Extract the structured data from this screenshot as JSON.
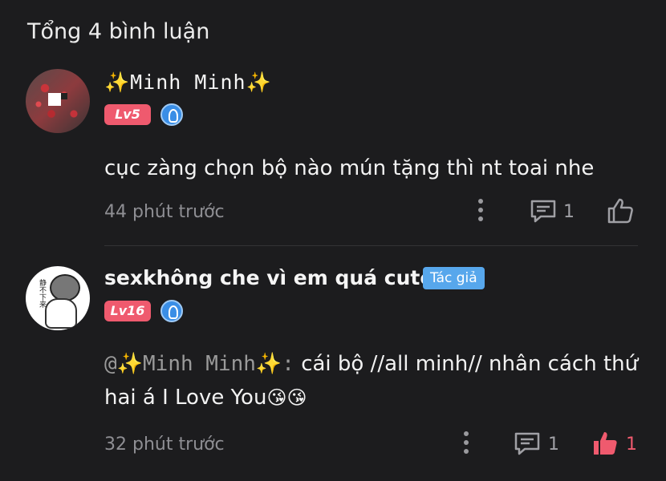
{
  "header": {
    "title": "Tổng 4 bình luận"
  },
  "comments": [
    {
      "name": "✨Minh Minh✨",
      "level": "Lv5",
      "text": "cục zàng chọn bộ nào mún tặng thì nt toai  nhe",
      "time": "44 phút trước",
      "reply_count": "1",
      "like_count": "",
      "liked": false
    },
    {
      "name": "sexkhông che vì em quá cute",
      "author_tag": "Tác giả",
      "level": "Lv16",
      "mention": "@✨Minh Minh✨:",
      "text": " cái bộ //all minh// nhân cách thứ hai á I Love You",
      "emoji": "😘😘",
      "time": "32 phút trước",
      "reply_count": "1",
      "like_count": "1",
      "liked": true
    }
  ],
  "colors": {
    "background": "#1c1c1e",
    "level_badge": "#ef5a6e",
    "author_tag": "#57a7ec",
    "liked": "#ef5a6e"
  }
}
